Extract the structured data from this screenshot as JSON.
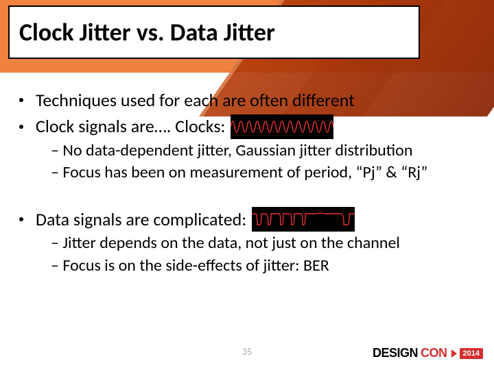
{
  "slide": {
    "title": "Clock Jitter vs. Data Jitter",
    "bullets": {
      "b1": "Techniques used for each are often different",
      "b2": "Clock signals are…. Clocks:",
      "b2_sub1": "– No data-dependent jitter, Gaussian jitter distribution",
      "b2_sub2": "– Focus has been on measurement of period, “Pj” & “Rj”",
      "b3": "Data signals are complicated:",
      "b3_sub1": "– Jitter depends on the data, not just on the channel",
      "b3_sub2": "– Focus is on the side-effects of jitter:  BER"
    },
    "page_number": "35",
    "logo": {
      "part1": "DESIGN",
      "part2": "CON",
      "year": "2014"
    }
  }
}
